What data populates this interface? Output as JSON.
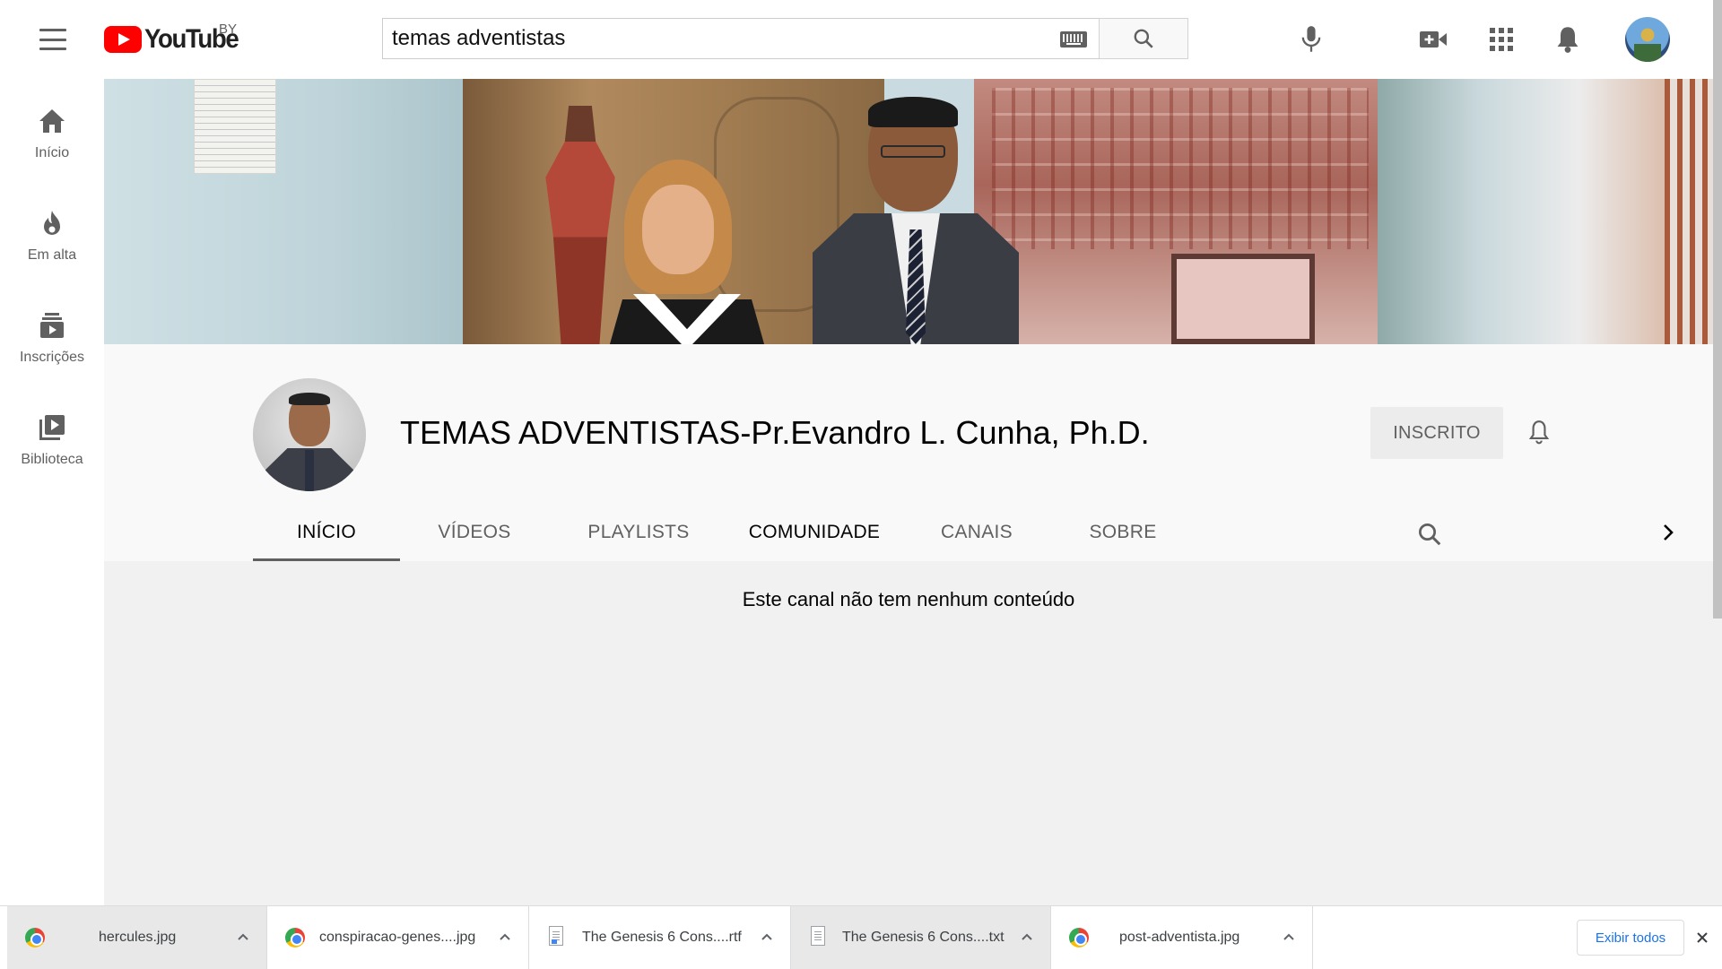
{
  "header": {
    "logo_text": "YouTube",
    "country_code": "BY",
    "search": {
      "value": "temas adventistas",
      "placeholder": "Pesquisar"
    }
  },
  "sidebar": {
    "items": [
      {
        "label": "Início",
        "icon": "home-icon"
      },
      {
        "label": "Em alta",
        "icon": "flame-icon"
      },
      {
        "label": "Inscrições",
        "icon": "subscriptions-icon"
      },
      {
        "label": "Biblioteca",
        "icon": "library-icon"
      }
    ]
  },
  "channel": {
    "title": "TEMAS ADVENTISTAS-Pr.Evandro L. Cunha, Ph.D.",
    "subscribe_label": "INSCRITO",
    "tabs": [
      {
        "label": "INÍCIO",
        "active": true
      },
      {
        "label": "VÍDEOS"
      },
      {
        "label": "PLAYLISTS"
      },
      {
        "label": "COMUNIDADE"
      },
      {
        "label": "CANAIS"
      },
      {
        "label": "SOBRE"
      }
    ]
  },
  "content": {
    "empty_message": "Este canal não tem nenhum conteúdo"
  },
  "downloads": {
    "items": [
      {
        "name": "hercules.jpg",
        "icon": "chrome-icon"
      },
      {
        "name": "conspiracao-genes....jpg",
        "icon": "chrome-icon"
      },
      {
        "name": "The Genesis 6 Cons....rtf",
        "icon": "document-icon"
      },
      {
        "name": "The Genesis 6 Cons....txt",
        "icon": "document-icon"
      },
      {
        "name": "post-adventista.jpg",
        "icon": "chrome-icon"
      }
    ],
    "show_all_label": "Exibir todos"
  },
  "colors": {
    "brand_red": "#ff0000",
    "icon_gray": "#606060",
    "link_blue": "#1a73e8"
  }
}
